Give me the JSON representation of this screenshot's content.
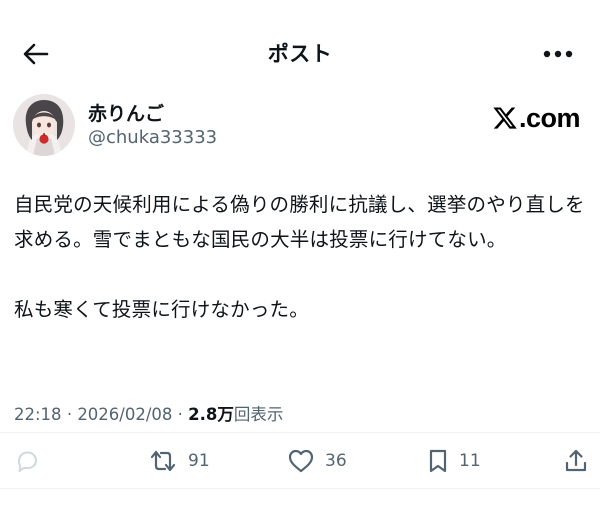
{
  "header": {
    "title": "ポスト",
    "back_icon": "arrow-left-icon",
    "more_icon": "more-horizontal-icon"
  },
  "author": {
    "display_name": "赤りんご",
    "handle": "@chuka33333"
  },
  "watermark": {
    "dotcom": ".com"
  },
  "tweet": {
    "paragraphs": [
      "自民党の天候利用による偽りの勝利に抗議し、選挙のやり直しを求める。雪でまともな国民の大半は投票に行けてない。",
      "私も寒くて投票に行けなかった。"
    ]
  },
  "meta": {
    "time": "22:18",
    "separator": "·",
    "date": "2026/02/08",
    "views_count": "2.8万",
    "views_label": "回表示"
  },
  "actions": {
    "reply_icon": "reply-bubble-icon",
    "repost_icon": "repost-icon",
    "repost_count": "91",
    "like_icon": "heart-icon",
    "like_count": "36",
    "bookmark_icon": "bookmark-icon",
    "bookmark_count": "11",
    "share_icon": "share-icon"
  },
  "colors": {
    "text": "#0f1419",
    "secondary": "#536471",
    "divider": "#eff3f4"
  }
}
